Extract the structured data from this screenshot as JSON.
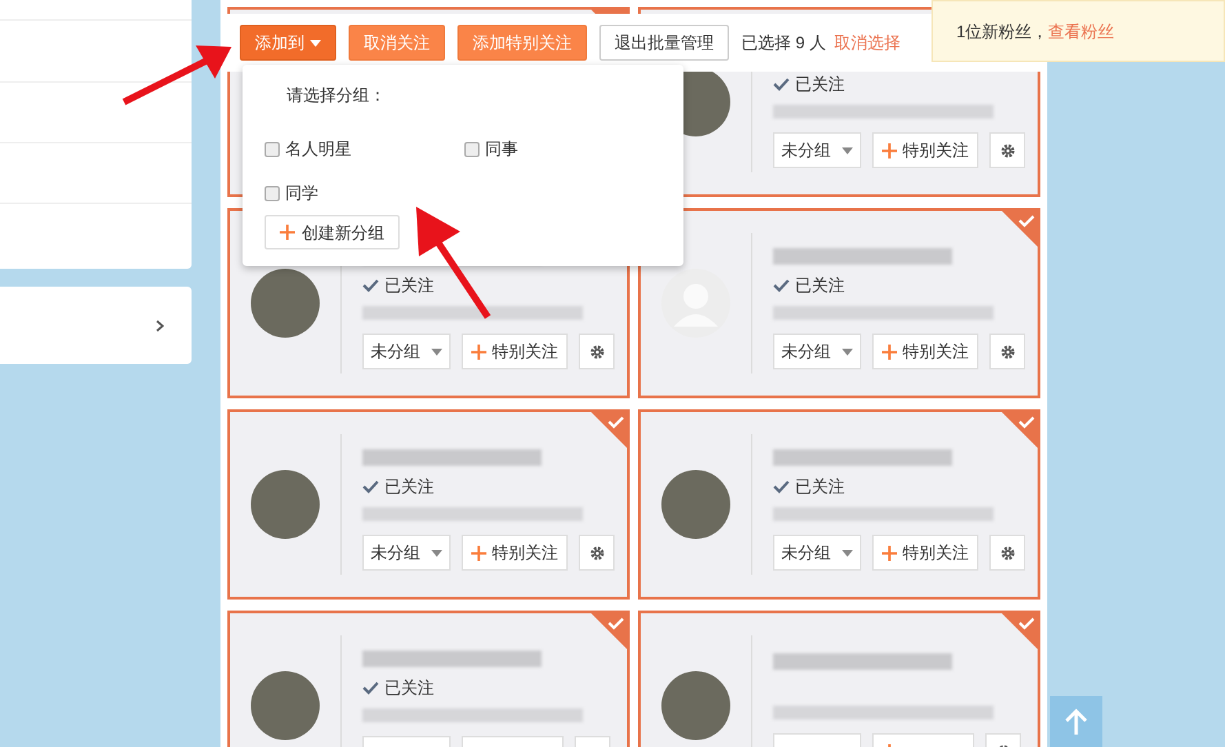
{
  "toolbar": {
    "buttons": [
      {
        "label": "添加到",
        "kind": "dropdown"
      },
      {
        "label": "取消关注",
        "kind": "action"
      },
      {
        "label": "添加特别关注",
        "kind": "action"
      },
      {
        "label": "退出批量管理",
        "kind": "plain"
      }
    ],
    "selected_count": "已选择 9 人",
    "clear_link": "取消选择"
  },
  "dropdown": {
    "title": "请选择分组：",
    "groups": [
      {
        "label": "名人明星",
        "checked": false
      },
      {
        "label": "同事",
        "checked": false
      },
      {
        "label": "同学",
        "checked": false
      }
    ],
    "create_button": "创建新分组"
  },
  "notification": {
    "text": "1位新粉丝，",
    "link": "查看粉丝"
  },
  "cards": [
    {
      "selected": true,
      "kind": "hidden"
    },
    {
      "selected": true,
      "kind": "photo",
      "followed": "已关注",
      "group": "未分组",
      "special": "特别关注"
    },
    {
      "selected": true,
      "kind": "photo",
      "followed": "已关注",
      "group": "未分组",
      "special": "特别关注"
    },
    {
      "selected": true,
      "kind": "default",
      "followed": "已关注",
      "group": "未分组",
      "special": "特别关注"
    },
    {
      "selected": true,
      "kind": "photo",
      "followed": "已关注",
      "group": "未分组",
      "special": "特别关注"
    },
    {
      "selected": true,
      "kind": "photo",
      "followed": "已关注",
      "group": "未分组",
      "special": "特别关注"
    },
    {
      "selected": true,
      "kind": "photo",
      "followed": "已关注"
    },
    {
      "selected": true,
      "kind": "photo"
    }
  ]
}
